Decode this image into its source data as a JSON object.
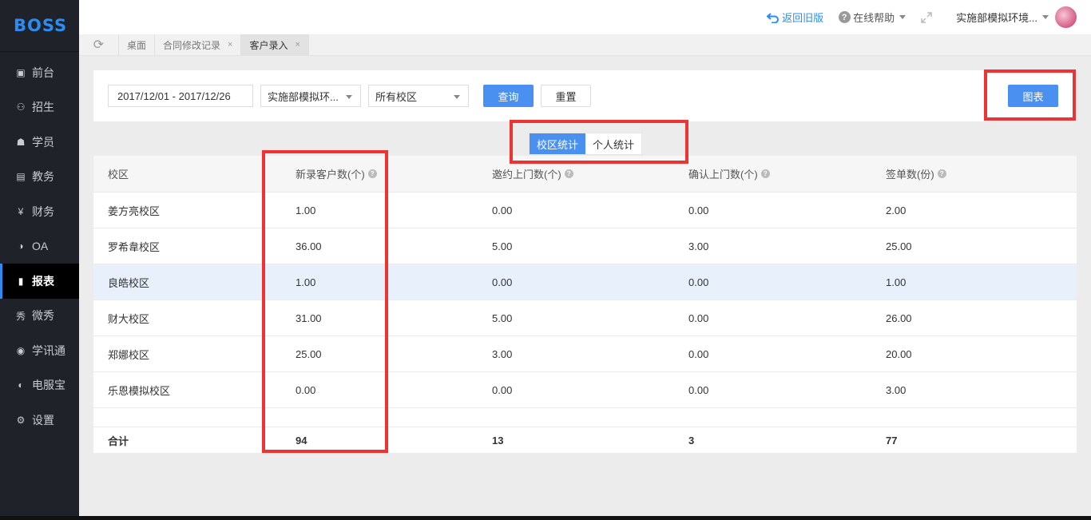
{
  "brand": {
    "logo": "BOSS"
  },
  "sidebar": {
    "items": [
      {
        "label": "前台",
        "icon": "calendar-icon",
        "glyph": "▣"
      },
      {
        "label": "招生",
        "icon": "user-plus-icon",
        "glyph": "⚇"
      },
      {
        "label": "学员",
        "icon": "id-card-icon",
        "glyph": "☗"
      },
      {
        "label": "教务",
        "icon": "book-icon",
        "glyph": "▤"
      },
      {
        "label": "财务",
        "icon": "yen-icon",
        "glyph": "¥"
      },
      {
        "label": "OA",
        "icon": "oa-icon",
        "glyph": "◑"
      },
      {
        "label": "报表",
        "icon": "bar-chart-icon",
        "glyph": "▮"
      },
      {
        "label": "微秀",
        "icon": "wechat-show-icon",
        "glyph": "秀"
      },
      {
        "label": "学讯通",
        "icon": "location-pin-icon",
        "glyph": "◉"
      },
      {
        "label": "电服宝",
        "icon": "phone-service-icon",
        "glyph": "◐"
      },
      {
        "label": "设置",
        "icon": "gear-icon",
        "glyph": "⚙"
      }
    ],
    "active_index": 6
  },
  "topbar": {
    "back_label": "返回旧版",
    "help_label": "在线帮助",
    "user_label": "实施部模拟环境..."
  },
  "tabs": [
    {
      "label": "桌面",
      "closable": false
    },
    {
      "label": "合同修改记录",
      "closable": true
    },
    {
      "label": "客户录入",
      "closable": true,
      "active": true
    }
  ],
  "filter": {
    "date_range": "2017/12/01 - 2017/12/26",
    "org_select": "实施部模拟环...",
    "campus_select": "所有校区",
    "query_button": "查询",
    "reset_button": "重置",
    "chart_button": "图表"
  },
  "segmented": {
    "options": [
      "校区统计",
      "个人统计"
    ],
    "active": 0
  },
  "table": {
    "headers": [
      "校区",
      "新录客户数(个)",
      "邀约上门数(个)",
      "确认上门数(个)",
      "签单数(份)"
    ],
    "rows": [
      [
        "姜方亮校区",
        "1.00",
        "0.00",
        "0.00",
        "2.00"
      ],
      [
        "罗希韋校区",
        "36.00",
        "5.00",
        "3.00",
        "25.00"
      ],
      [
        "良皓校区",
        "1.00",
        "0.00",
        "0.00",
        "1.00"
      ],
      [
        "财大校区",
        "31.00",
        "5.00",
        "0.00",
        "26.00"
      ],
      [
        "郑娜校区",
        "25.00",
        "3.00",
        "0.00",
        "20.00"
      ],
      [
        "乐恩模拟校区",
        "0.00",
        "0.00",
        "0.00",
        "3.00"
      ]
    ],
    "highlight_row": 2,
    "total": [
      "合计",
      "94",
      "13",
      "3",
      "77"
    ]
  },
  "colors": {
    "accent": "#4a90f0",
    "sidebar": "#1f2329",
    "annotation": "#ee3333"
  }
}
